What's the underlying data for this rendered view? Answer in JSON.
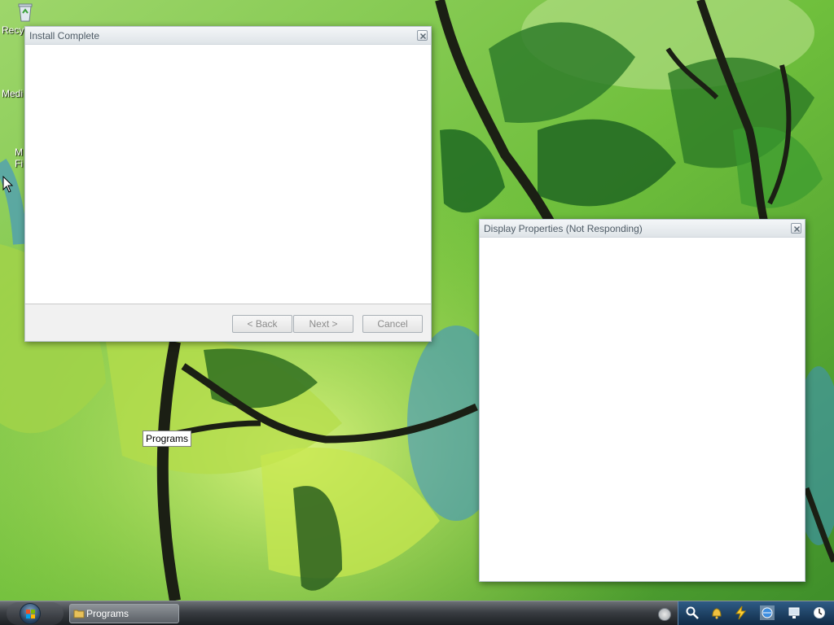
{
  "desktop": {
    "icons": [
      {
        "label": "Recy",
        "icon": "recycle-bin-icon"
      },
      {
        "label": "Medi",
        "icon": "media-player-icon"
      },
      {
        "label": "M",
        "label2": "Fi",
        "icon": "media-file-icon"
      }
    ]
  },
  "install_window": {
    "title": "Install Complete",
    "buttons": {
      "back": "< Back",
      "next": "Next >",
      "cancel": "Cancel"
    }
  },
  "display_window": {
    "title": "Display Properties (Not Responding)"
  },
  "tooltip": {
    "text": "Programs"
  },
  "taskbar": {
    "tasks": [
      {
        "label": "Programs",
        "icon": "folder-icon"
      }
    ],
    "tray_icons": [
      "search-icon",
      "bell-icon",
      "lightning-icon",
      "browser-icon",
      "network-icon",
      "clock-icon"
    ]
  },
  "colors": {
    "tray_background": "#0f2944",
    "window_title_text": "#4e5b66"
  }
}
